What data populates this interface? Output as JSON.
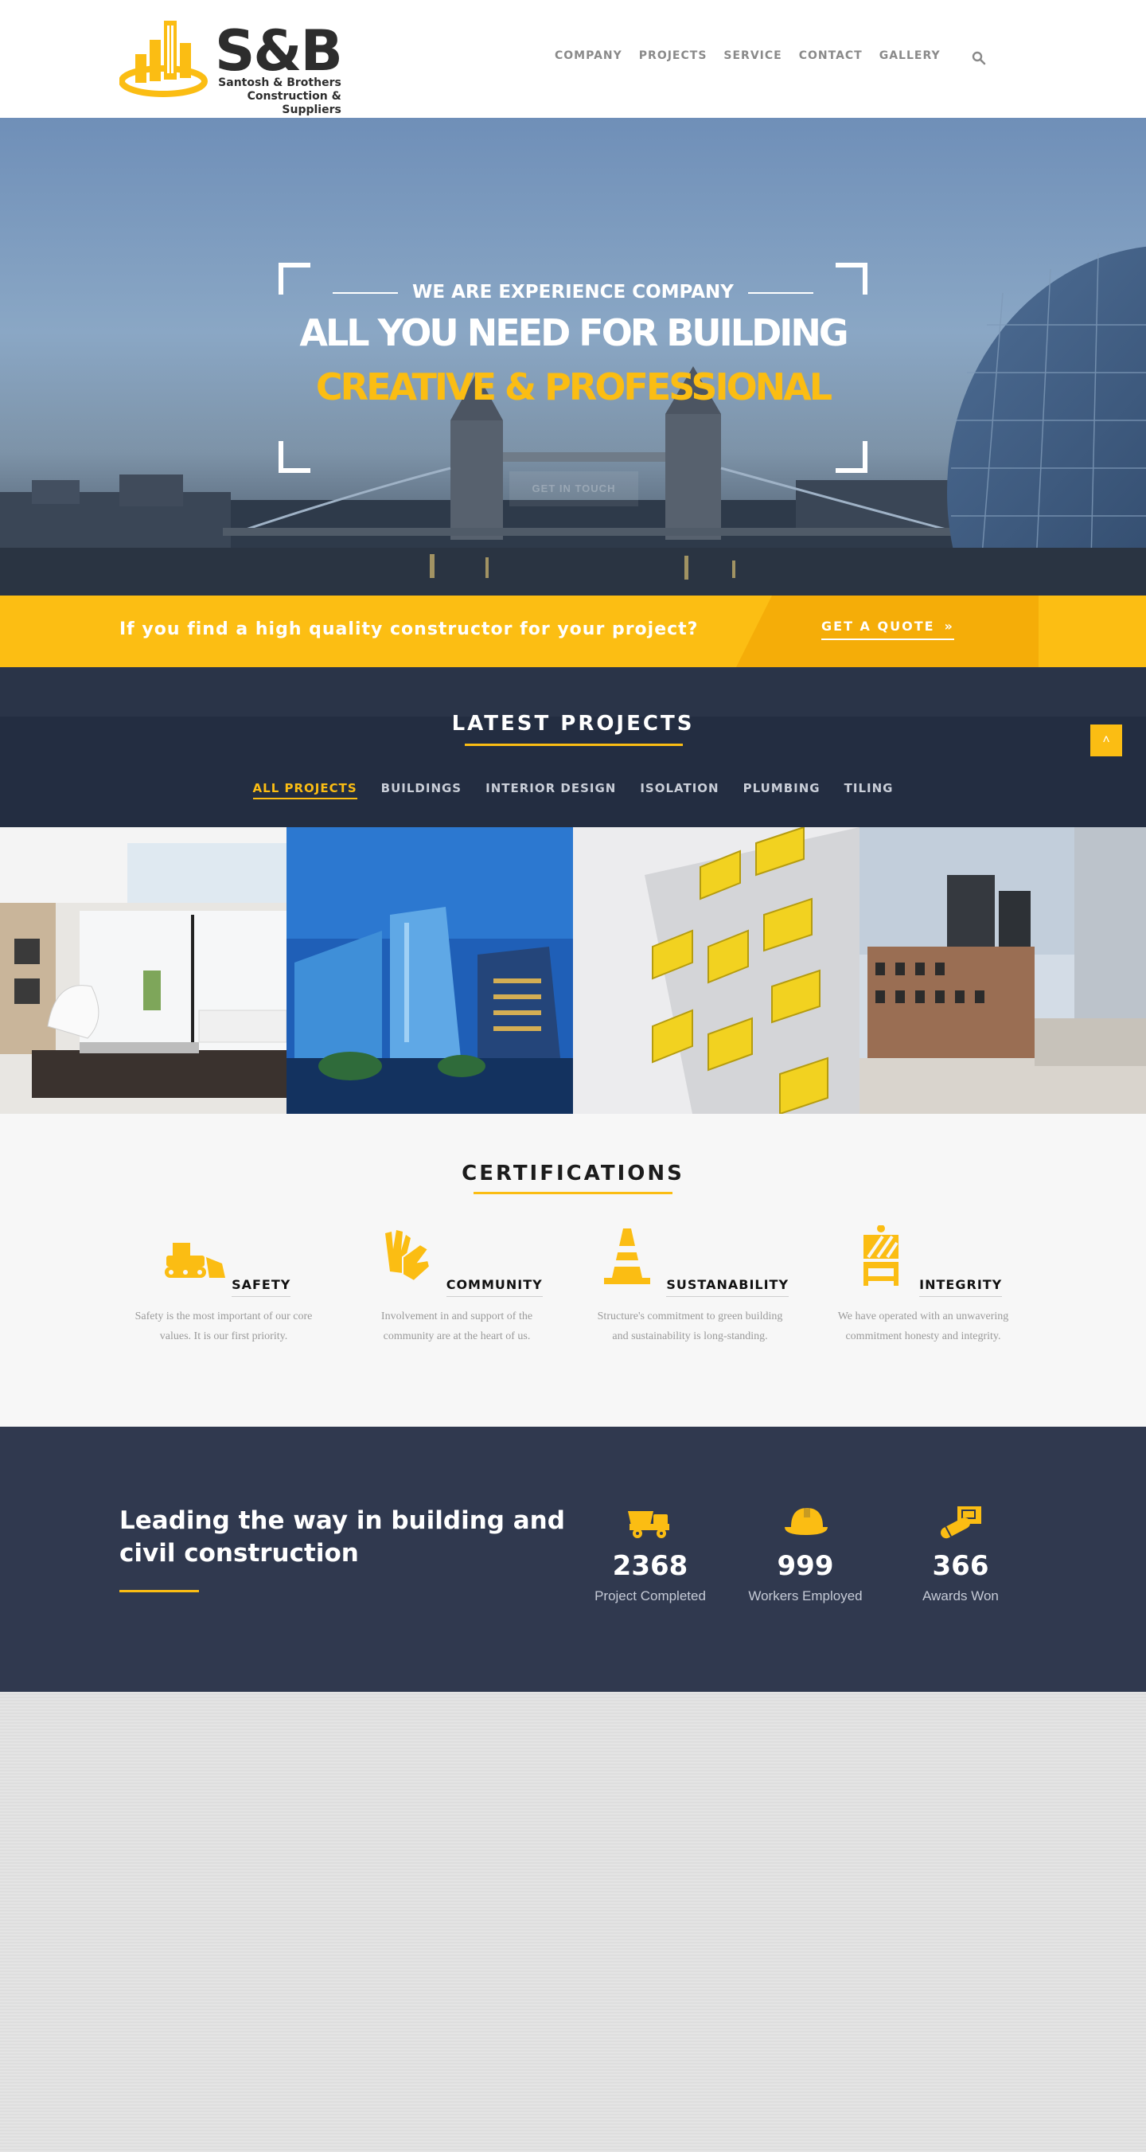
{
  "brand": {
    "name": "S&B",
    "line1": "Santosh & Brothers",
    "line2": "Construction & Suppliers"
  },
  "nav": {
    "items": [
      "COMPANY",
      "PROJECTS",
      "SERVICE",
      "CONTACT",
      "GALLERY"
    ]
  },
  "hero": {
    "eyebrow": "WE ARE EXPERIENCE COMPANY",
    "title": "ALL YOU NEED FOR BUILDING",
    "subtitle": "CREATIVE & PROFESSIONAL",
    "button": "GET IN TOUCH"
  },
  "quote": {
    "text": "If you find a high quality constructor for your project?",
    "button": "GET A QUOTE",
    "button_icon": "double-chevron-right"
  },
  "projects": {
    "title": "LATEST PROJECTS",
    "filters": [
      "ALL PROJECTS",
      "BUILDINGS",
      "INTERIOR DESIGN",
      "ISOLATION",
      "PLUMBING",
      "TILING"
    ],
    "active_filter": "ALL PROJECTS"
  },
  "certifications": {
    "title": "CERTIFICATIONS",
    "items": [
      {
        "name": "SAFETY",
        "icon": "bulldozer-icon",
        "desc": "Safety is the most important of our core values. It is our first priority."
      },
      {
        "name": "COMMUNITY",
        "icon": "gloves-icon",
        "desc": "Involvement in and support of the community are at the heart of us."
      },
      {
        "name": "SUSTANABILITY",
        "icon": "traffic-cone-icon",
        "desc": "Structure's commitment to green building and sustainability is long-standing."
      },
      {
        "name": "INTEGRITY",
        "icon": "road-barrier-icon",
        "desc": "We have operated with an unwavering commitment honesty and integrity."
      }
    ]
  },
  "stats": {
    "heading": "Leading the way in building and civil construction",
    "items": [
      {
        "value": "2368",
        "label": "Project Completed",
        "icon": "dump-truck-icon"
      },
      {
        "value": "999",
        "label": "Workers Employed",
        "icon": "hard-hat-icon"
      },
      {
        "value": "366",
        "label": "Awards Won",
        "icon": "blueprint-icon"
      }
    ]
  },
  "colors": {
    "accent": "#fbbd13",
    "navy": "#232d41",
    "stats_bg": "#30394f"
  }
}
